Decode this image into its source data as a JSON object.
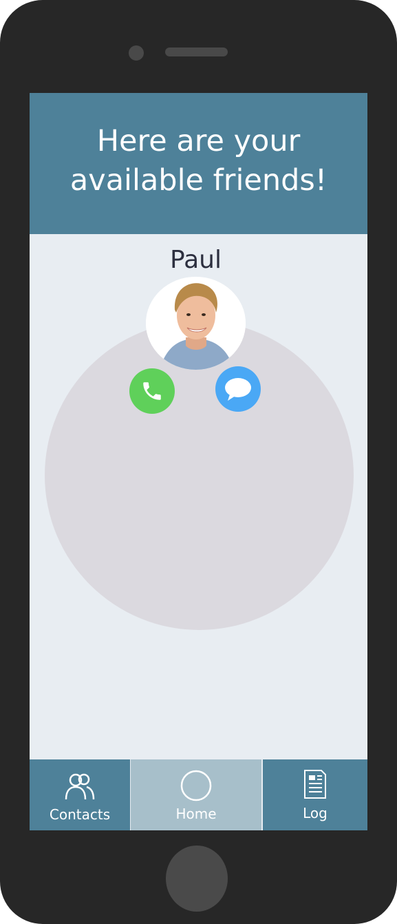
{
  "header": {
    "title": "Here are your\navailable friends!"
  },
  "friend": {
    "name": "Paul",
    "avatar_icon": "person-photo",
    "actions": {
      "call_icon": "phone-icon",
      "message_icon": "chat-bubble-icon"
    }
  },
  "tabs": [
    {
      "label": "Contacts",
      "icon": "contacts-icon",
      "selected": false
    },
    {
      "label": "Home",
      "icon": "circle-icon",
      "selected": true
    },
    {
      "label": "Log",
      "icon": "document-icon",
      "selected": false
    }
  ],
  "colors": {
    "header_bg": "#4e8199",
    "screen_bg": "#e8edf2",
    "circle_bg": "#dbd9df",
    "call_green": "#5fd05a",
    "message_blue": "#4aa8f5",
    "tab_selected_bg": "#a7bfca",
    "device_body": "#272727"
  }
}
